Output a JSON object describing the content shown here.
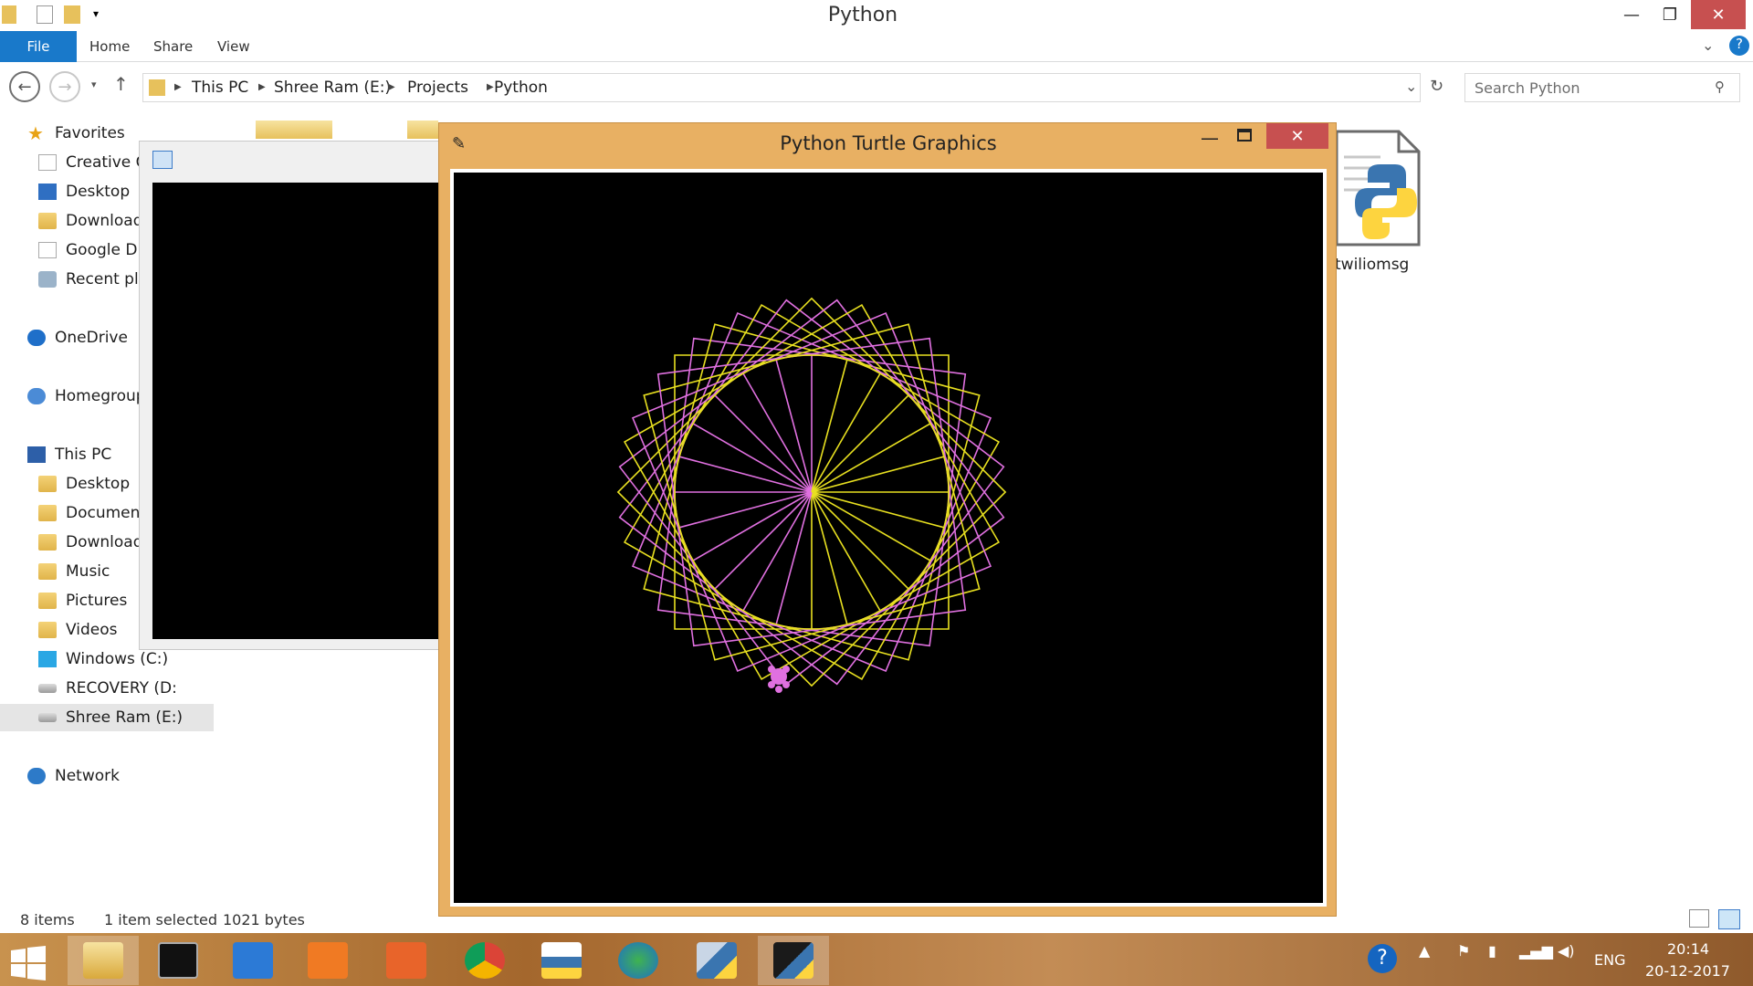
{
  "window": {
    "title": "Python"
  },
  "ribbon": {
    "file": "File",
    "home": "Home",
    "share": "Share",
    "view": "View"
  },
  "address": {
    "crumbs": [
      "This PC",
      "Shree Ram (E:)",
      "Projects",
      "Python"
    ],
    "search_placeholder": "Search Python"
  },
  "nav_pane": {
    "favorites": "Favorites",
    "fav_items": [
      "Creative Cl",
      "Desktop",
      "Download:",
      "Google Dri",
      "Recent pla"
    ],
    "onedrive": "OneDrive",
    "homegroup": "Homegroup",
    "this_pc": "This PC",
    "pc_items": [
      "Desktop",
      "Document",
      "Download:",
      "Music",
      "Pictures",
      "Videos",
      "Windows (C:)",
      "RECOVERY (D:)",
      "Shree Ram (E:)"
    ],
    "network": "Network"
  },
  "files": {
    "twiliomsg": "twiliomsg"
  },
  "status": {
    "items": "8 items",
    "selected": "1 item selected",
    "size": "1021 bytes"
  },
  "turtle_window": {
    "title": "Python Turtle Graphics",
    "pen_color_a": "#e070e0",
    "pen_color_b": "#e8e020"
  },
  "taskbar": {
    "apps": [
      "File Explorer",
      "Command Prompt",
      "Visual Studio Code",
      "Snipping Tool",
      "Screen Capture",
      "Google Chrome",
      "Python File",
      "Internet Download Manager",
      "Python Launcher",
      "Python Shell"
    ],
    "lang": "ENG",
    "time": "20:14",
    "date": "20-12-2017"
  }
}
